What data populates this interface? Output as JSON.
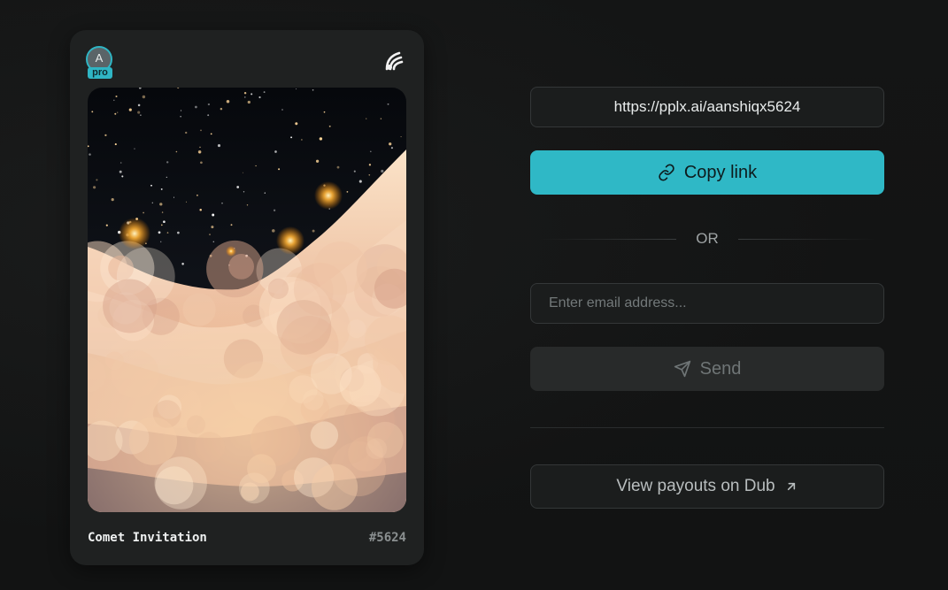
{
  "card": {
    "avatar_letter": "A",
    "badge": "pro",
    "title": "Comet Invitation",
    "number": "#5624",
    "brand_icon": "perplexity-comet-icon"
  },
  "share": {
    "url": "https://pplx.ai/aanshiqx5624",
    "copy_label": "Copy link",
    "copy_icon": "link-icon",
    "or_label": "OR",
    "email_placeholder": "Enter email address...",
    "email_value": "",
    "send_label": "Send",
    "send_icon": "paper-plane-icon",
    "payouts_label": "View payouts on Dub",
    "payouts_icon": "arrow-up-right-icon"
  },
  "colors": {
    "accent": "#2fb8c6",
    "background": "#121313",
    "card": "#1f2121"
  }
}
